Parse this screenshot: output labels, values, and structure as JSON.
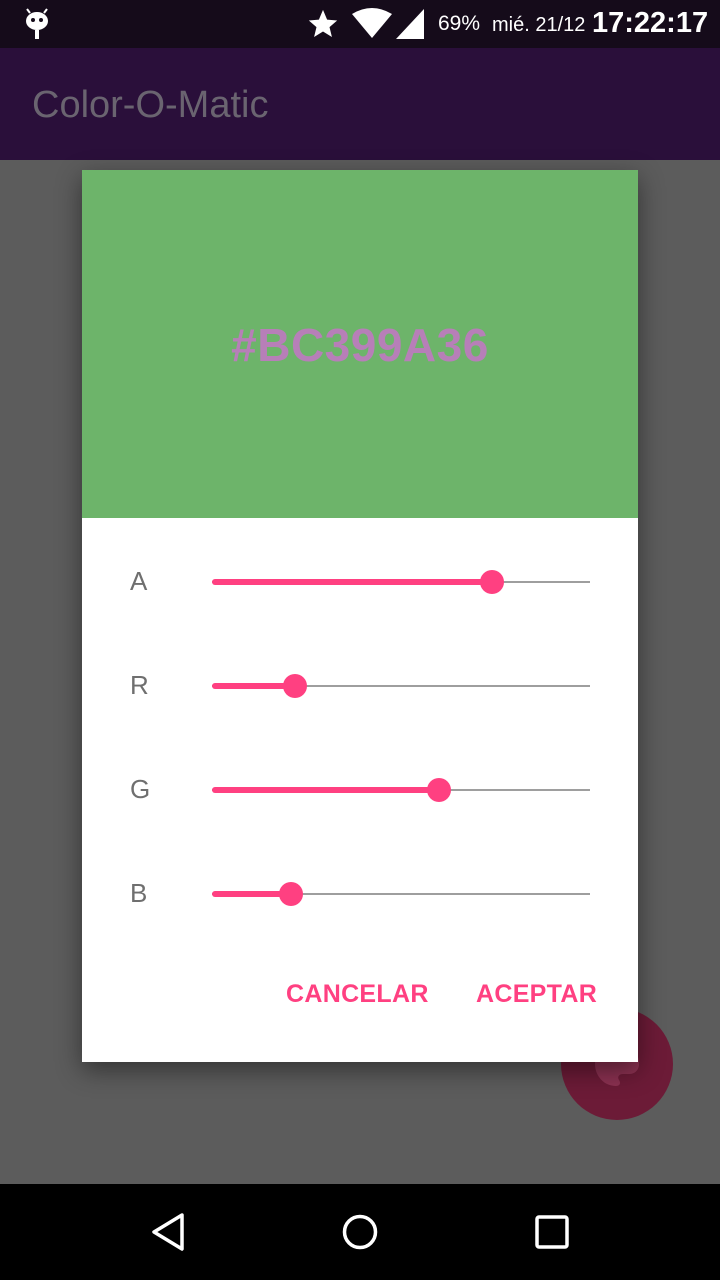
{
  "status_bar": {
    "battery": "69%",
    "date": "mié. 21/12",
    "time": "17:22:17",
    "icons": [
      "android-debug-icon",
      "star-icon",
      "wifi-icon",
      "signal-icon"
    ]
  },
  "app_bar": {
    "title": "Color-O-Matic"
  },
  "dialog": {
    "preview_color": "#6db46a",
    "hex_text": "#BC399A36",
    "hex_text_color": "#b77fb8",
    "sliders": [
      {
        "label": "A",
        "value": 0.74
      },
      {
        "label": "R",
        "value": 0.22
      },
      {
        "label": "G",
        "value": 0.6
      },
      {
        "label": "B",
        "value": 0.21
      }
    ],
    "accent_color": "#ff4081",
    "cancel_label": "CANCELAR",
    "accept_label": "ACEPTAR"
  },
  "fab": {
    "icon": "palette-icon"
  },
  "nav_bar": {
    "icons": [
      "back-icon",
      "home-icon",
      "recents-icon"
    ]
  }
}
